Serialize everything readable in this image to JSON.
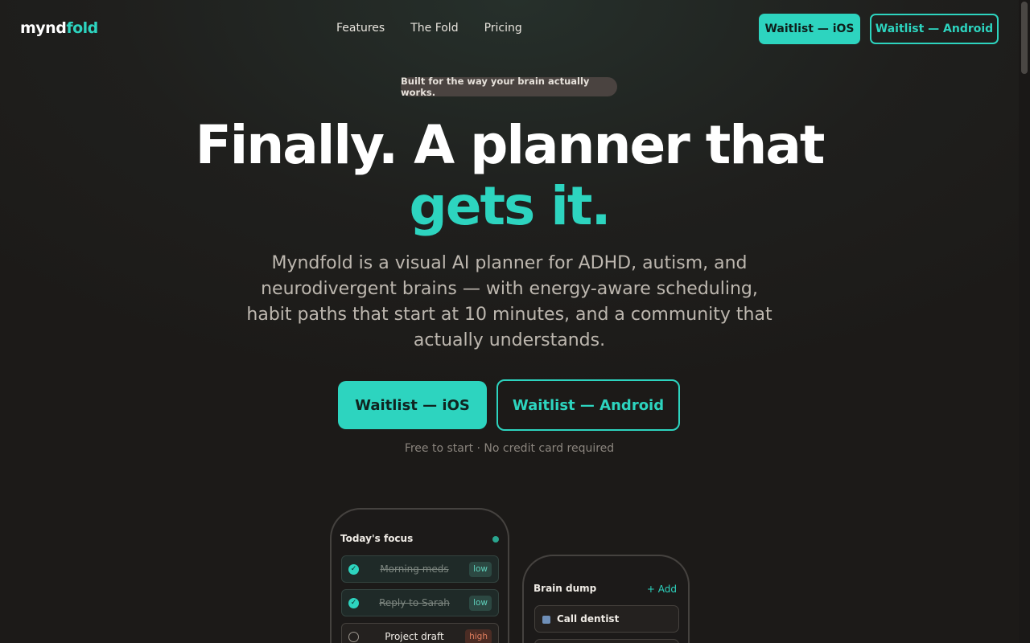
{
  "nav": {
    "logo_part1": "mynd",
    "logo_part2": "fold",
    "links": [
      "Features",
      "The Fold",
      "Pricing"
    ],
    "waitlist_ios": "Waitlist — iOS",
    "waitlist_android": "Waitlist — Android"
  },
  "hero": {
    "badge": "Built for the way your brain actually works.",
    "headline_line1": "Finally. A planner that",
    "headline_line2": "gets it.",
    "subtitle": "Myndfold is a visual AI planner for ADHD, autism, and neurodivergent brains — with energy-aware scheduling, habit paths that start at 10 minutes, and a community that actually understands.",
    "cta_ios": "Waitlist — iOS",
    "cta_android": "Waitlist — Android",
    "note": "Free to start · No credit card required"
  },
  "phone_focus": {
    "title": "Today's focus",
    "tasks": [
      {
        "label": "Morning meds",
        "done": true,
        "priority": "low"
      },
      {
        "label": "Reply to Sarah",
        "done": true,
        "priority": "low"
      },
      {
        "label": "Project draft",
        "done": false,
        "priority": "high"
      }
    ]
  },
  "phone_dump": {
    "title": "Brain dump",
    "add_label": "+ Add",
    "items": [
      "Call dentist"
    ]
  },
  "colors": {
    "accent": "#2dd4bf",
    "background": "#1c1a18",
    "high_priority": "#e07e5e"
  }
}
